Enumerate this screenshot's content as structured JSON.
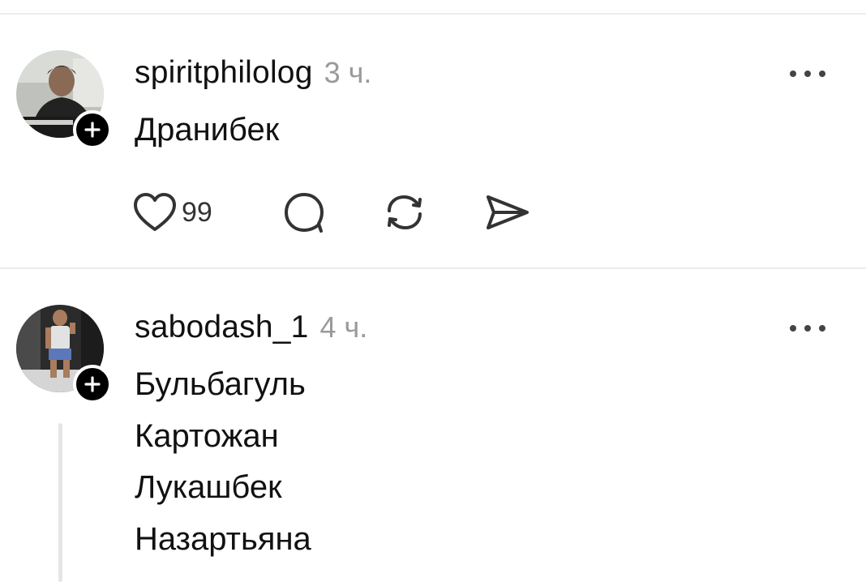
{
  "posts": [
    {
      "username": "spiritphilolog",
      "time": "3 ч.",
      "lines": [
        "Дранибек"
      ],
      "likes": "99"
    },
    {
      "username": "sabodash_1",
      "time": "4 ч.",
      "lines": [
        "Бульбагуль",
        "Картожан",
        "Лукашбек",
        "Назартьяна"
      ]
    }
  ],
  "icons": {
    "like": "heart-icon",
    "reply": "comment-bubble-icon",
    "repost": "repost-icon",
    "share": "send-icon",
    "more": "more-dots-icon",
    "follow": "plus-icon"
  },
  "colors": {
    "text": "#111111",
    "muted": "#9a9a9a",
    "divider": "#ececec"
  }
}
